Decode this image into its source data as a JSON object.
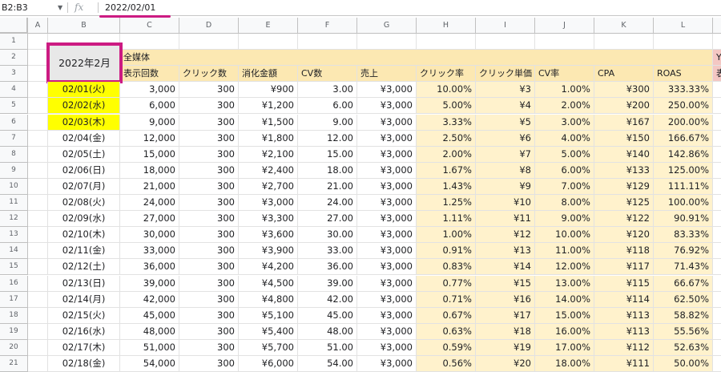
{
  "formula_bar": {
    "name_box": "B2:B3",
    "fx_label": "fx",
    "value": "2022/02/01"
  },
  "columns": [
    "A",
    "B",
    "C",
    "D",
    "E",
    "F",
    "G",
    "H",
    "I",
    "J",
    "K",
    "L"
  ],
  "title": "2022年2月",
  "group_label": "全媒体",
  "next_group_label": "Yah",
  "next_group_subheader": "表示",
  "headers": [
    "表示回数",
    "クリック数",
    "消化金額",
    "CV数",
    "売上",
    "クリック率",
    "クリック単価",
    "CV率",
    "CPA",
    "ROAS"
  ],
  "rows": [
    {
      "date": "02/01(火)",
      "imp": "3,000",
      "clicks": "300",
      "cost": "¥900",
      "cv": "3.00",
      "sales": "¥3,000",
      "ctr": "10.00%",
      "cpc": "¥3",
      "cvr": "1.00%",
      "cpa": "¥300",
      "roas": "333.33%",
      "highlight": true
    },
    {
      "date": "02/02(水)",
      "imp": "6,000",
      "clicks": "300",
      "cost": "¥1,200",
      "cv": "6.00",
      "sales": "¥3,000",
      "ctr": "5.00%",
      "cpc": "¥4",
      "cvr": "2.00%",
      "cpa": "¥200",
      "roas": "250.00%",
      "highlight": true
    },
    {
      "date": "02/03(木)",
      "imp": "9,000",
      "clicks": "300",
      "cost": "¥1,500",
      "cv": "9.00",
      "sales": "¥3,000",
      "ctr": "3.33%",
      "cpc": "¥5",
      "cvr": "3.00%",
      "cpa": "¥167",
      "roas": "200.00%",
      "highlight": true
    },
    {
      "date": "02/04(金)",
      "imp": "12,000",
      "clicks": "300",
      "cost": "¥1,800",
      "cv": "12.00",
      "sales": "¥3,000",
      "ctr": "2.50%",
      "cpc": "¥6",
      "cvr": "4.00%",
      "cpa": "¥150",
      "roas": "166.67%",
      "highlight": false
    },
    {
      "date": "02/05(土)",
      "imp": "15,000",
      "clicks": "300",
      "cost": "¥2,100",
      "cv": "15.00",
      "sales": "¥3,000",
      "ctr": "2.00%",
      "cpc": "¥7",
      "cvr": "5.00%",
      "cpa": "¥140",
      "roas": "142.86%",
      "highlight": false
    },
    {
      "date": "02/06(日)",
      "imp": "18,000",
      "clicks": "300",
      "cost": "¥2,400",
      "cv": "18.00",
      "sales": "¥3,000",
      "ctr": "1.67%",
      "cpc": "¥8",
      "cvr": "6.00%",
      "cpa": "¥133",
      "roas": "125.00%",
      "highlight": false
    },
    {
      "date": "02/07(月)",
      "imp": "21,000",
      "clicks": "300",
      "cost": "¥2,700",
      "cv": "21.00",
      "sales": "¥3,000",
      "ctr": "1.43%",
      "cpc": "¥9",
      "cvr": "7.00%",
      "cpa": "¥129",
      "roas": "111.11%",
      "highlight": false
    },
    {
      "date": "02/08(火)",
      "imp": "24,000",
      "clicks": "300",
      "cost": "¥3,000",
      "cv": "24.00",
      "sales": "¥3,000",
      "ctr": "1.25%",
      "cpc": "¥10",
      "cvr": "8.00%",
      "cpa": "¥125",
      "roas": "100.00%",
      "highlight": false
    },
    {
      "date": "02/09(水)",
      "imp": "27,000",
      "clicks": "300",
      "cost": "¥3,300",
      "cv": "27.00",
      "sales": "¥3,000",
      "ctr": "1.11%",
      "cpc": "¥11",
      "cvr": "9.00%",
      "cpa": "¥122",
      "roas": "90.91%",
      "highlight": false
    },
    {
      "date": "02/10(木)",
      "imp": "30,000",
      "clicks": "300",
      "cost": "¥3,600",
      "cv": "30.00",
      "sales": "¥3,000",
      "ctr": "1.00%",
      "cpc": "¥12",
      "cvr": "10.00%",
      "cpa": "¥120",
      "roas": "83.33%",
      "highlight": false
    },
    {
      "date": "02/11(金)",
      "imp": "33,000",
      "clicks": "300",
      "cost": "¥3,900",
      "cv": "33.00",
      "sales": "¥3,000",
      "ctr": "0.91%",
      "cpc": "¥13",
      "cvr": "11.00%",
      "cpa": "¥118",
      "roas": "76.92%",
      "highlight": false
    },
    {
      "date": "02/12(土)",
      "imp": "36,000",
      "clicks": "300",
      "cost": "¥4,200",
      "cv": "36.00",
      "sales": "¥3,000",
      "ctr": "0.83%",
      "cpc": "¥14",
      "cvr": "12.00%",
      "cpa": "¥117",
      "roas": "71.43%",
      "highlight": false
    },
    {
      "date": "02/13(日)",
      "imp": "39,000",
      "clicks": "300",
      "cost": "¥4,500",
      "cv": "39.00",
      "sales": "¥3,000",
      "ctr": "0.77%",
      "cpc": "¥15",
      "cvr": "13.00%",
      "cpa": "¥115",
      "roas": "66.67%",
      "highlight": false
    },
    {
      "date": "02/14(月)",
      "imp": "42,000",
      "clicks": "300",
      "cost": "¥4,800",
      "cv": "42.00",
      "sales": "¥3,000",
      "ctr": "0.71%",
      "cpc": "¥16",
      "cvr": "14.00%",
      "cpa": "¥114",
      "roas": "62.50%",
      "highlight": false
    },
    {
      "date": "02/15(火)",
      "imp": "45,000",
      "clicks": "300",
      "cost": "¥5,100",
      "cv": "45.00",
      "sales": "¥3,000",
      "ctr": "0.67%",
      "cpc": "¥17",
      "cvr": "15.00%",
      "cpa": "¥113",
      "roas": "58.82%",
      "highlight": false
    },
    {
      "date": "02/16(水)",
      "imp": "48,000",
      "clicks": "300",
      "cost": "¥5,400",
      "cv": "48.00",
      "sales": "¥3,000",
      "ctr": "0.63%",
      "cpc": "¥18",
      "cvr": "16.00%",
      "cpa": "¥113",
      "roas": "55.56%",
      "highlight": false
    },
    {
      "date": "02/17(木)",
      "imp": "51,000",
      "clicks": "300",
      "cost": "¥5,700",
      "cv": "51.00",
      "sales": "¥3,000",
      "ctr": "0.59%",
      "cpc": "¥19",
      "cvr": "17.00%",
      "cpa": "¥112",
      "roas": "52.63%",
      "highlight": false
    },
    {
      "date": "02/18(金)",
      "imp": "54,000",
      "clicks": "300",
      "cost": "¥6,000",
      "cv": "54.00",
      "sales": "¥3,000",
      "ctr": "0.56%",
      "cpc": "¥20",
      "cvr": "18.00%",
      "cpa": "¥111",
      "roas": "50.00%",
      "highlight": false
    }
  ],
  "colors": {
    "accent_magenta": "#cc1b82",
    "header_orange": "#fce8b2",
    "metric_fill": "#fff2cc",
    "date_highlight": "#ffff00",
    "yahoo_header": "#f4c7c3"
  }
}
